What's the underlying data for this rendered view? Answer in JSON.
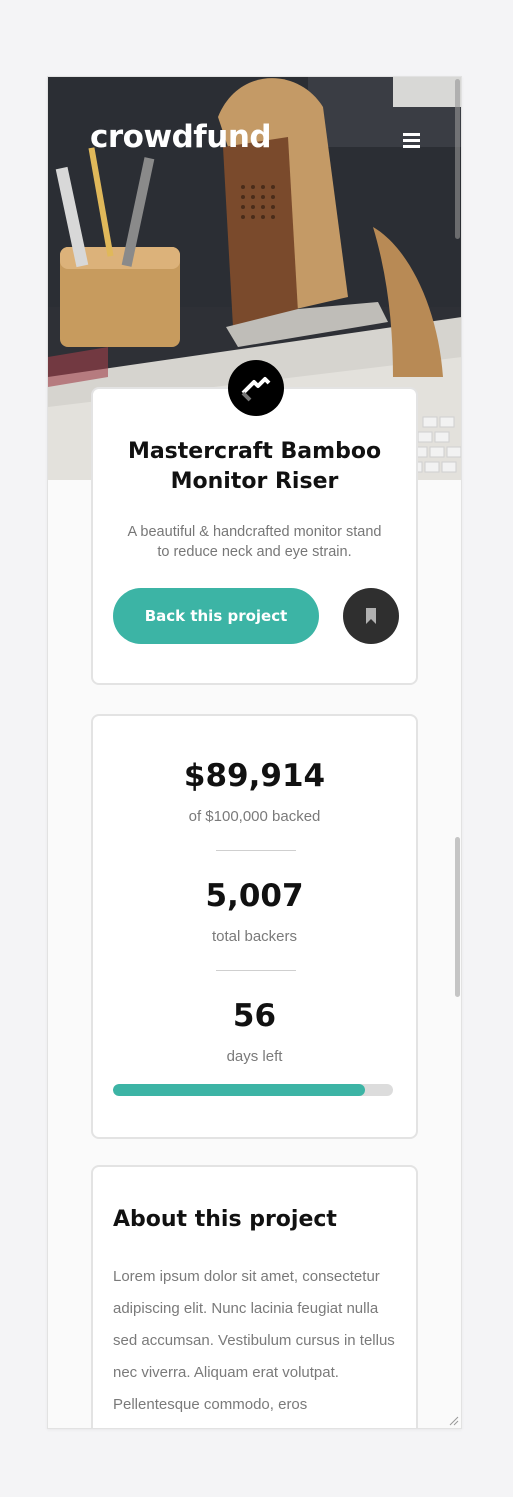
{
  "header": {
    "brand": "crowdfund",
    "menu_icon": "hamburger-icon"
  },
  "intro": {
    "logo_icon": "mastercraft-logo-icon",
    "title": "Mastercraft Bamboo Monitor Riser",
    "description": "A beautiful & handcrafted monitor stand to reduce neck and eye strain.",
    "back_label": "Back this project",
    "bookmark_icon": "bookmark-icon"
  },
  "stats": {
    "backed_amount": "$89,914",
    "backed_label": "of $100,000 backed",
    "backers": "5,007",
    "backers_label": "total backers",
    "days": "56",
    "days_label": "days left",
    "progress_fraction": 0.899
  },
  "about": {
    "title": "About this project",
    "text": "Lorem ipsum dolor sit amet, consectetur adipiscing elit. Nunc lacinia feugiat nulla sed accumsan. Vestibulum cursus in tellus nec viverra. Aliquam erat volutpat. Pellentesque commodo, eros"
  },
  "colors": {
    "accent": "#3cb4a5",
    "dark": "#2f2f2f"
  }
}
